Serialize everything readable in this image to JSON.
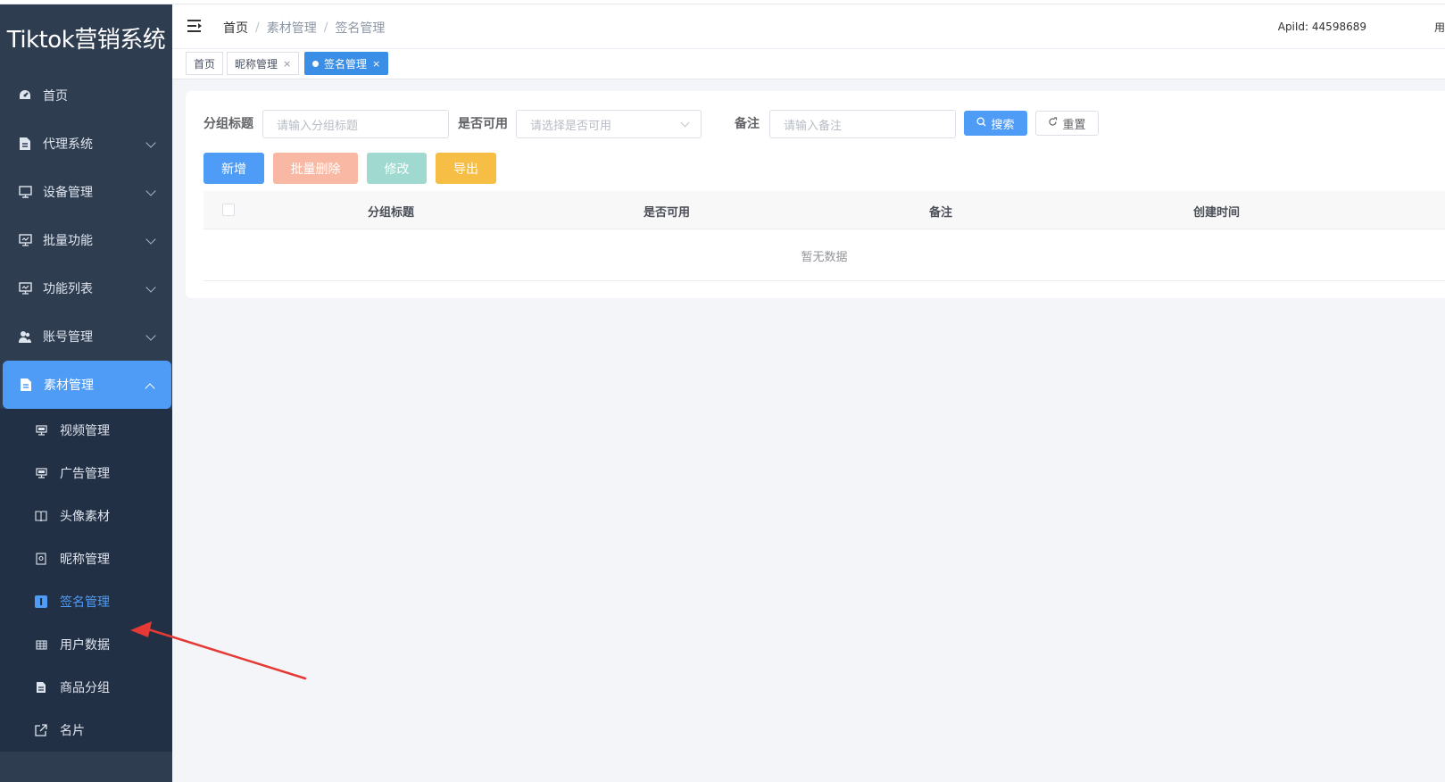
{
  "app": {
    "title": "Tiktok营销系统"
  },
  "sidebar": {
    "items": [
      {
        "label": "首页",
        "icon": "dashboard-icon"
      },
      {
        "label": "代理系统",
        "icon": "document-icon"
      },
      {
        "label": "设备管理",
        "icon": "monitor-icon"
      },
      {
        "label": "批量功能",
        "icon": "monitor-icon"
      },
      {
        "label": "功能列表",
        "icon": "monitor-icon"
      },
      {
        "label": "账号管理",
        "icon": "users-icon"
      },
      {
        "label": "素材管理",
        "icon": "document-icon",
        "active": true
      }
    ],
    "subitems": [
      {
        "label": "视频管理",
        "icon": "monitor-icon"
      },
      {
        "label": "广告管理",
        "icon": "monitor-icon"
      },
      {
        "label": "头像素材",
        "icon": "book-icon"
      },
      {
        "label": "昵称管理",
        "icon": "image-icon"
      },
      {
        "label": "签名管理",
        "icon": "text-icon",
        "selected": true
      },
      {
        "label": "用户数据",
        "icon": "table-icon"
      },
      {
        "label": "商品分组",
        "icon": "document-icon"
      },
      {
        "label": "名片",
        "icon": "external-link-icon"
      }
    ]
  },
  "header": {
    "breadcrumb": [
      "首页",
      "素材管理",
      "签名管理"
    ],
    "separator": "/",
    "apiid": "ApiId: 44598689",
    "extra": "用"
  },
  "tabs": [
    {
      "label": "首页"
    },
    {
      "label": "昵称管理",
      "close": "×"
    },
    {
      "label": "签名管理",
      "close": "×",
      "current": true
    }
  ],
  "search": {
    "group_title_label": "分组标题",
    "group_title_placeholder": "请输入分组标题",
    "available_label": "是否可用",
    "available_placeholder": "请选择是否可用",
    "remark_label": "备注",
    "remark_placeholder": "请输入备注",
    "search_button": "搜索",
    "reset_button": "重置"
  },
  "actions": {
    "add": "新增",
    "batch_delete": "批量删除",
    "edit": "修改",
    "export": "导出"
  },
  "table": {
    "columns": [
      "分组标题",
      "是否可用",
      "备注",
      "创建时间"
    ],
    "empty_text": "暂无数据"
  },
  "colors": {
    "sidebar": "#2f3d51",
    "accent": "#4f9cf7",
    "batch_delete": "#f9b8a4",
    "edit": "#9fd9cf",
    "export": "#f6be45"
  }
}
